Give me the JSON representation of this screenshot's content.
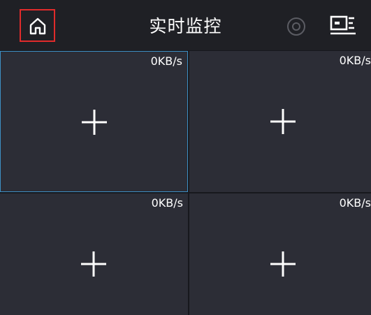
{
  "header": {
    "title": "实时监控",
    "icons": [
      "home-icon",
      "settings-icon",
      "camera-icon"
    ],
    "accent_color": "#e02b2b"
  },
  "channels": [
    {
      "speed": "0KB/s",
      "selected": true,
      "icon": "plus-icon"
    },
    {
      "speed": "0KB/s",
      "selected": false,
      "icon": "plus-icon"
    },
    {
      "speed": "0KB/s",
      "selected": false,
      "icon": "plus-icon"
    },
    {
      "speed": "0KB/s",
      "selected": false,
      "icon": "plus-icon"
    }
  ],
  "colors": {
    "background": "#17181d",
    "tile": "#2c2d36",
    "selected_border": "#3d8fc4"
  }
}
